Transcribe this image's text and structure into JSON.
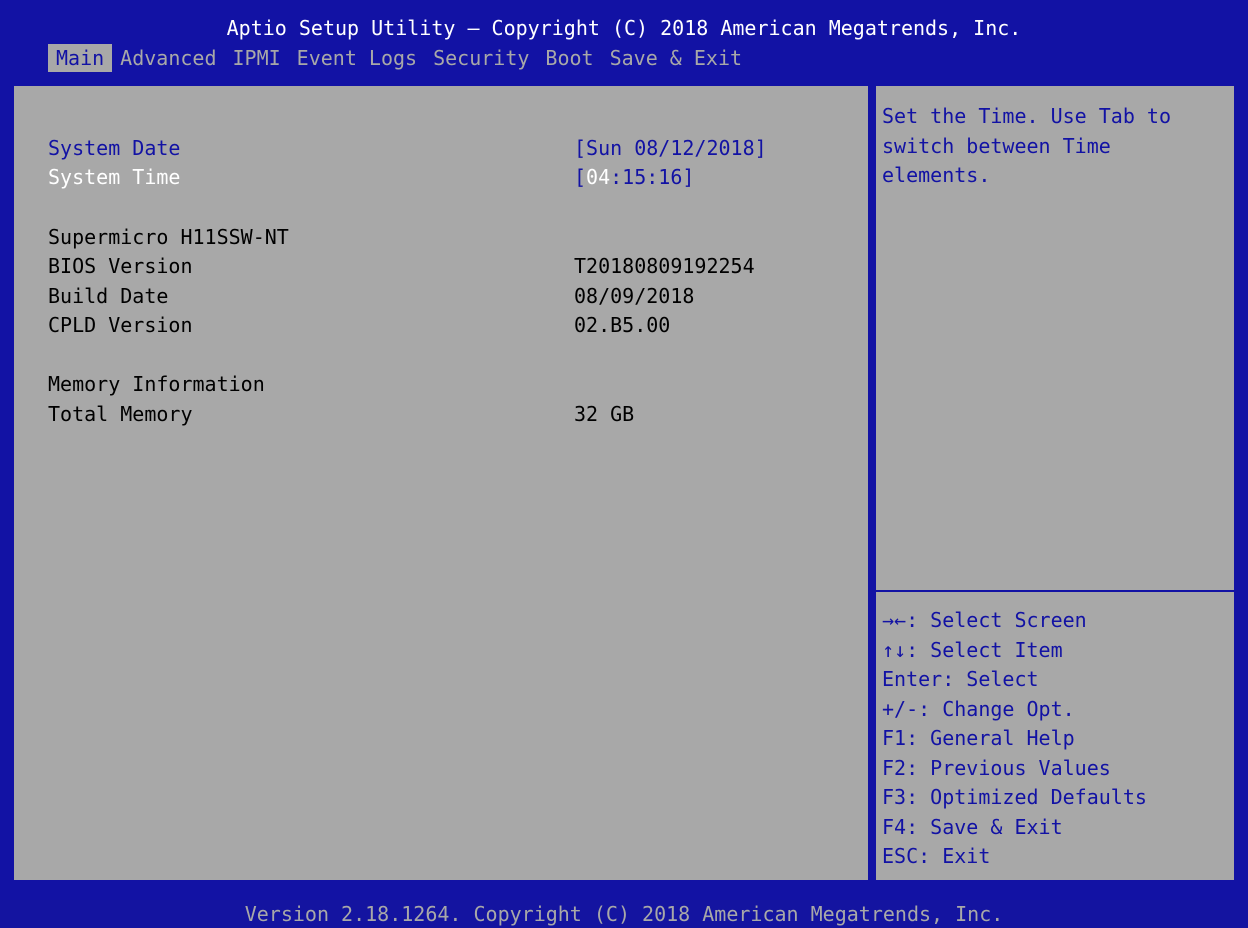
{
  "title": "Aptio Setup Utility – Copyright (C) 2018 American Megatrends, Inc.",
  "tabs": [
    "Main",
    "Advanced",
    "IPMI",
    "Event Logs",
    "Security",
    "Boot",
    "Save & Exit"
  ],
  "main": {
    "system_date_label": "System Date",
    "system_date_value": "[Sun 08/12/2018]",
    "system_time_label": "System Time",
    "system_time_open": "[",
    "system_time_hour": "04",
    "system_time_rest": ":15:16]",
    "board_name": "Supermicro H11SSW-NT",
    "bios_version_label": "BIOS Version",
    "bios_version_value": "T20180809192254",
    "build_date_label": "Build Date",
    "build_date_value": "08/09/2018",
    "cpld_version_label": "CPLD Version",
    "cpld_version_value": "02.B5.00",
    "memory_info_label": "Memory Information",
    "total_memory_label": "Total Memory",
    "total_memory_value": "32 GB"
  },
  "help": {
    "lines": [
      "Set the Time. Use Tab to",
      "switch between Time",
      "elements."
    ]
  },
  "keys": [
    "→←: Select Screen",
    "↑↓: Select Item",
    "Enter: Select",
    "+/-: Change Opt.",
    "F1: General Help",
    "F2: Previous Values",
    "F3: Optimized Defaults",
    "F4: Save & Exit",
    "ESC: Exit"
  ],
  "footer": "Version 2.18.1264. Copyright (C) 2018 American Megatrends, Inc.",
  "colors": {
    "background_blue": "#1212a4",
    "panel_gray": "#a8a8a8",
    "selected_text": "#ffffff"
  }
}
